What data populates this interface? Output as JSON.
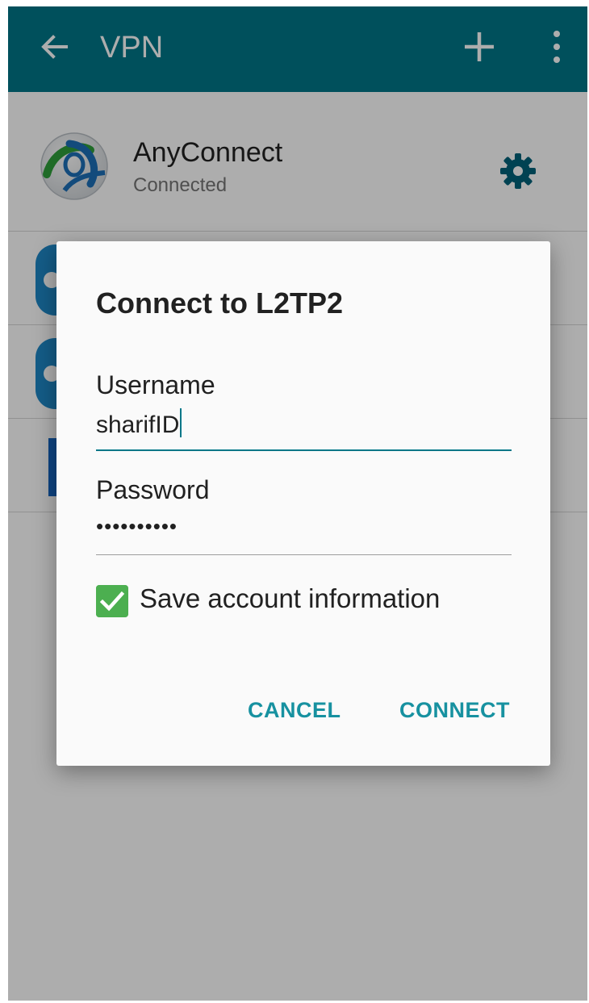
{
  "appbar": {
    "title": "VPN",
    "back_icon": "arrow-left-icon",
    "add_icon": "plus-icon",
    "more_icon": "overflow-menu-icon",
    "color": "#017788"
  },
  "vpn_list": {
    "items": [
      {
        "name": "AnyConnect",
        "status": "Connected"
      }
    ]
  },
  "dialog": {
    "title": "Connect to L2TP2",
    "username": {
      "label": "Username",
      "value": "sharifID"
    },
    "password": {
      "label": "Password",
      "value": "••••••••••"
    },
    "save_account": {
      "label": "Save account information",
      "checked": true
    },
    "cancel_label": "CANCEL",
    "connect_label": "CONNECT",
    "accent_color": "#1791a0"
  }
}
